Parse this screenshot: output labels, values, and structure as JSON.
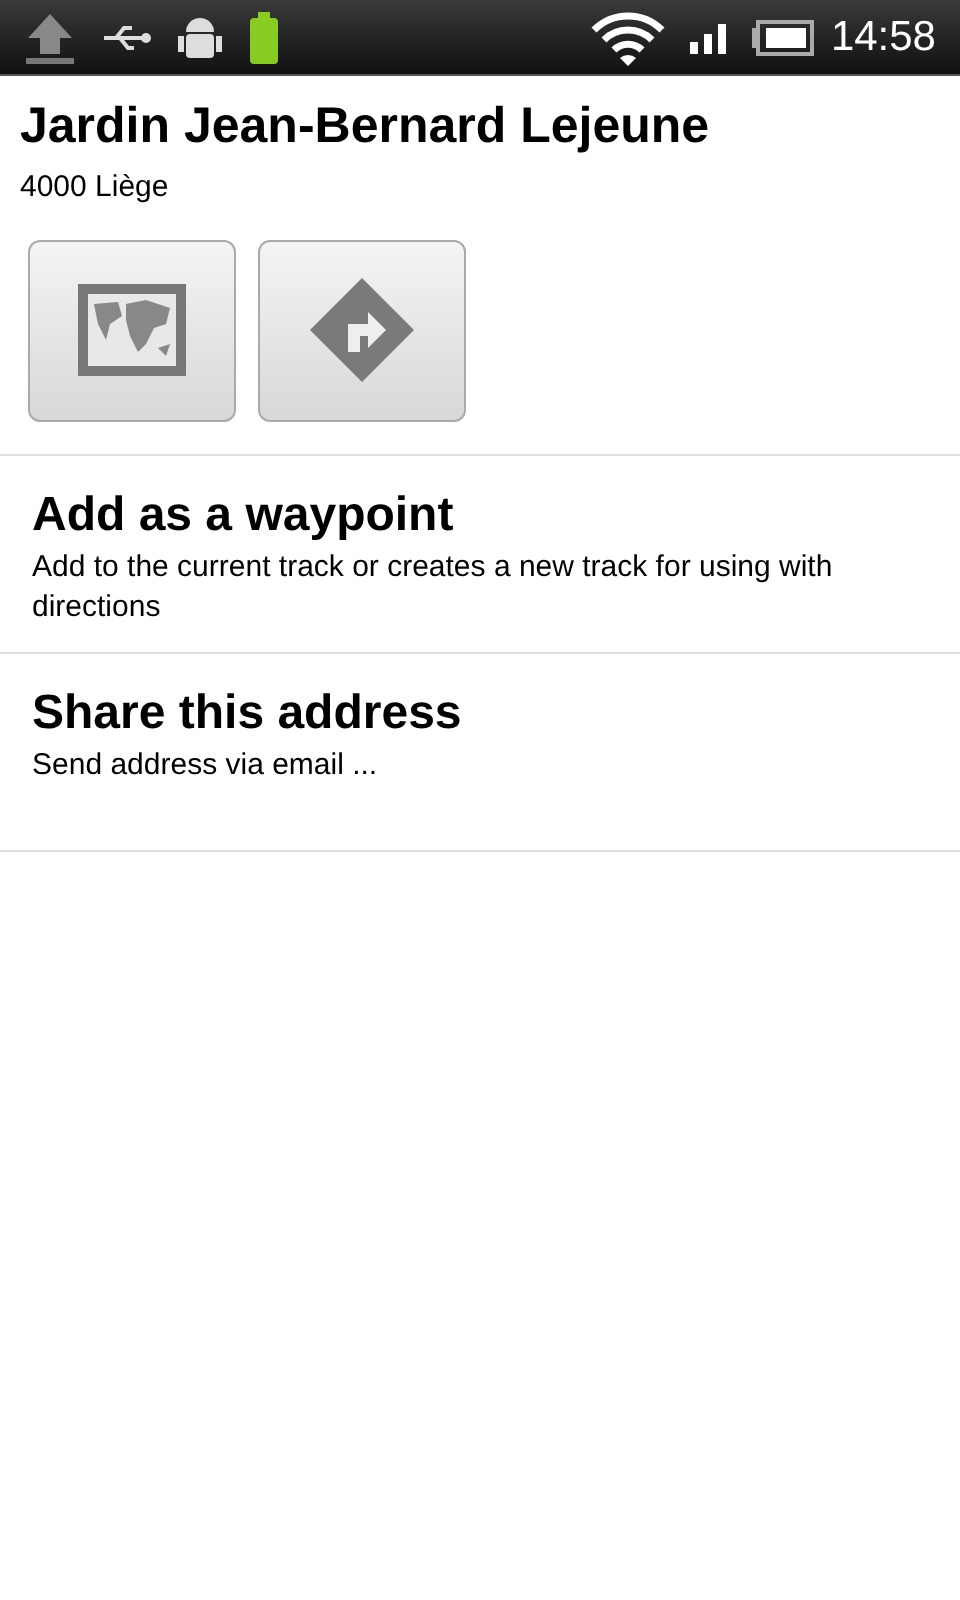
{
  "status_bar": {
    "time": "14:58"
  },
  "place": {
    "name": "Jardin Jean-Bernard Lejeune",
    "address": "4000 Liège"
  },
  "action_buttons": [
    {
      "kind": "map"
    },
    {
      "kind": "directions"
    }
  ],
  "menu_items": [
    {
      "title": "Add as a waypoint",
      "description": "Add to the current track or creates a new track for using with directions"
    },
    {
      "title": "Share this address",
      "description": "Send address via email ..."
    }
  ]
}
